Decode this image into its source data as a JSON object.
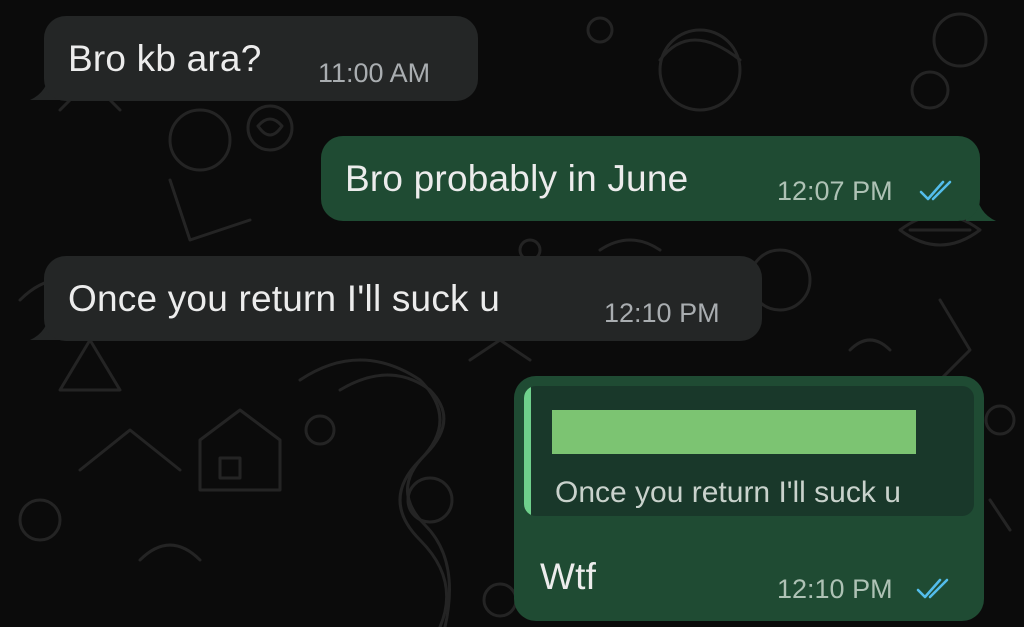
{
  "messages": [
    {
      "text": "Bro kb ara?",
      "time": "11:00 AM",
      "direction": "incoming"
    },
    {
      "text": "Bro probably in June",
      "time": "12:07 PM",
      "direction": "outgoing",
      "status": "read"
    },
    {
      "text": "Once you return I'll suck u",
      "time": "12:10 PM",
      "direction": "incoming"
    },
    {
      "text": "Wtf",
      "time": "12:10 PM",
      "direction": "outgoing",
      "status": "read",
      "reply_to": {
        "text": "Once you return I'll suck u",
        "sender_redacted": true
      }
    }
  ],
  "colors": {
    "background": "#0b0b0b",
    "incoming_bubble": "#242626",
    "outgoing_bubble": "#1f4b33",
    "quote_bar": "#6fd08c",
    "redaction": "#7cc472",
    "read_tick": "#53bdeb"
  },
  "icons": {
    "read_receipt": "double-check-icon"
  }
}
